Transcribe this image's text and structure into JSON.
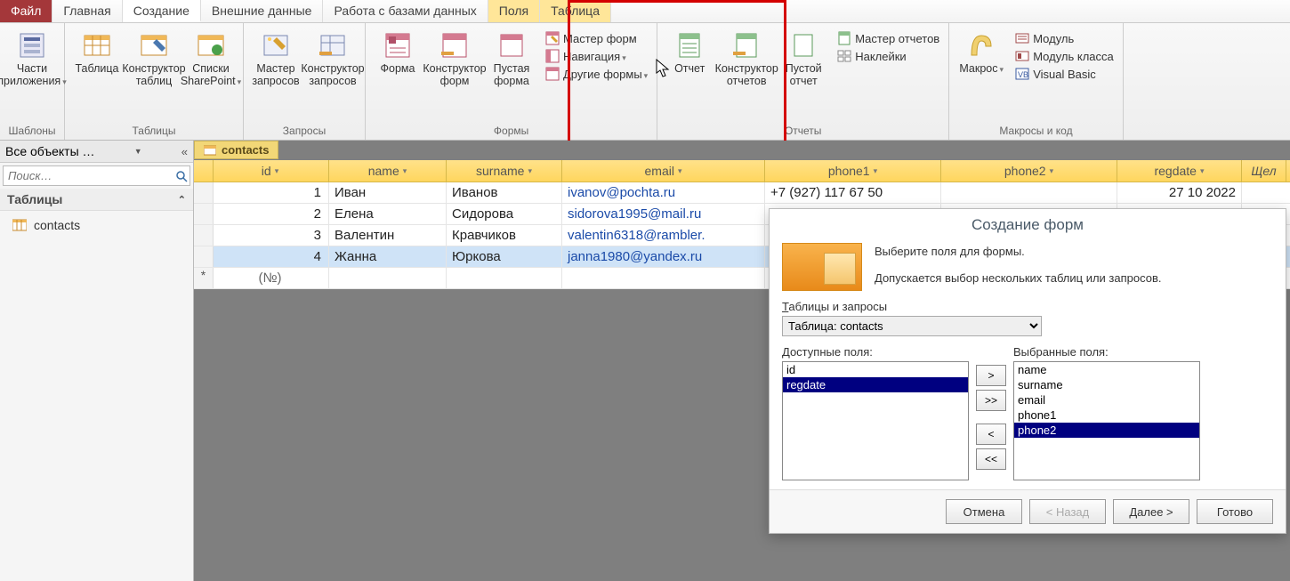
{
  "tabs": {
    "file": "Файл",
    "home": "Главная",
    "create": "Создание",
    "external": "Внешние данные",
    "dbtools": "Работа с базами данных",
    "fields": "Поля",
    "table": "Таблица"
  },
  "ribbon": {
    "templates": {
      "label": "Шаблоны",
      "app_parts": "Части\nприложения"
    },
    "tables": {
      "label": "Таблицы",
      "table": "Таблица",
      "table_design": "Конструктор\nтаблиц",
      "sharepoint": "Списки\nSharePoint"
    },
    "queries": {
      "label": "Запросы",
      "qwizard": "Мастер\nзапросов",
      "qdesign": "Конструктор\nзапросов"
    },
    "forms": {
      "label": "Формы",
      "form": "Форма",
      "form_design": "Конструктор\nформ",
      "blank_form": "Пустая\nформа",
      "form_wizard": "Мастер форм",
      "navigation": "Навигация",
      "more_forms": "Другие формы"
    },
    "reports": {
      "label": "Отчеты",
      "report": "Отчет",
      "report_design": "Конструктор\nотчетов",
      "blank_report": "Пустой\nотчет",
      "report_wizard": "Мастер отчетов",
      "labels": "Наклейки"
    },
    "macros": {
      "label": "Макросы и код",
      "macro": "Макрос",
      "module": "Модуль",
      "class_module": "Модуль класса",
      "vb": "Visual Basic"
    }
  },
  "nav": {
    "header": "Все объекты …",
    "collapse": "«",
    "search_placeholder": "Поиск…",
    "section": "Таблицы",
    "section_chev": "ˆ",
    "item": "contacts"
  },
  "doc_tab": "contacts",
  "datasheet": {
    "columns": [
      "id",
      "name",
      "surname",
      "email",
      "phone1",
      "phone2",
      "regdate"
    ],
    "more_col": "Щел",
    "new_row_placeholder": "(№)",
    "rows": [
      {
        "id": "1",
        "name": "Иван",
        "surname": "Иванов",
        "email": "ivanov@pochta.ru",
        "phone1": "+7 (927) 117 67 50",
        "phone2": "",
        "regdate": "27 10 2022"
      },
      {
        "id": "2",
        "name": "Елена",
        "surname": "Сидорова",
        "email": "sidorova1995@mail.ru",
        "phone1": "",
        "phone2": "",
        "regdate": ""
      },
      {
        "id": "3",
        "name": "Валентин",
        "surname": "Кравчиков",
        "email": "valentin6318@rambler.",
        "phone1": "",
        "phone2": "",
        "regdate": ""
      },
      {
        "id": "4",
        "name": "Жанна",
        "surname": "Юркова",
        "email": "janna1980@yandex.ru",
        "phone1": "",
        "phone2": "",
        "regdate": ""
      }
    ],
    "selected_row_index": 3
  },
  "wizard": {
    "title": "Создание форм",
    "intro1": "Выберите поля для формы.",
    "intro2": "Допускается выбор нескольких таблиц или запросов.",
    "tables_label": "Таблицы и запросы",
    "combo_value": "Таблица: contacts",
    "avail_label": "Доступные поля:",
    "selected_label": "Выбранные поля:",
    "available": [
      "id",
      "regdate"
    ],
    "available_selected_index": 1,
    "selected": [
      "name",
      "surname",
      "email",
      "phone1",
      "phone2"
    ],
    "selected_selected_index": 4,
    "move_right": ">",
    "move_all_right": ">>",
    "move_left": "<",
    "move_all_left": "<<",
    "btn_cancel": "Отмена",
    "btn_back": "< Назад",
    "btn_next": "Далее >",
    "btn_finish": "Готово"
  }
}
